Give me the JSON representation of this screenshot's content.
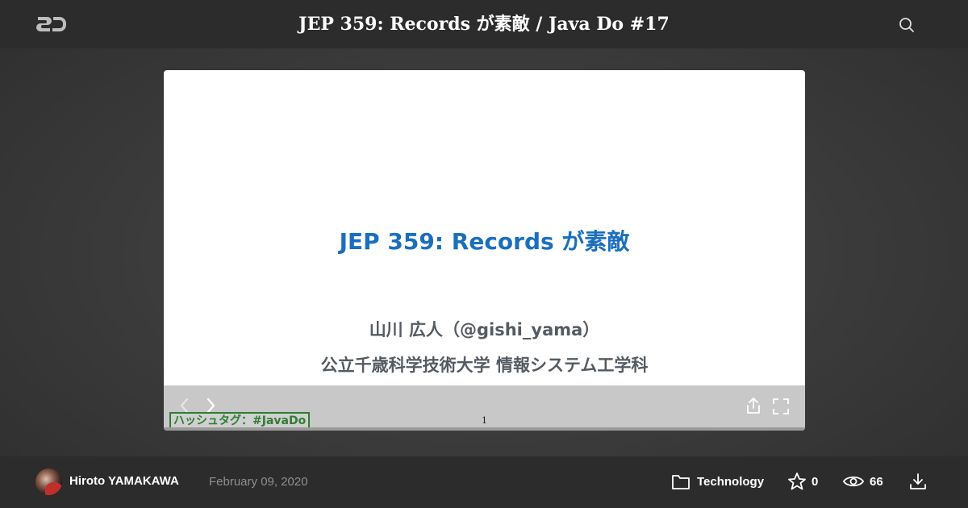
{
  "header": {
    "logo": "SD",
    "title": "JEP 359: Records が素敵 / Java Do #17",
    "search_icon": "search-icon"
  },
  "slide": {
    "title": "JEP 359: Records が素敵",
    "author": "山川 広人（@gishi_yama）",
    "affiliation": "公立千歳科学技術大学 情報システム工学科",
    "hashtag": "ハッシュタグ：#JavaDo",
    "page_number": "1",
    "colors": {
      "title": "#1a6fbd",
      "body": "#555b62",
      "hashtag": "#2e7d32"
    },
    "controls": [
      "chevron-left-icon",
      "chevron-right-icon",
      "share-icon",
      "fullscreen-icon"
    ]
  },
  "footer": {
    "author_name": "Hiroto YAMAKAWA",
    "date": "February 09, 2020",
    "category": "Technology",
    "stars": "0",
    "views": "66",
    "icons": [
      "folder-icon",
      "star-icon",
      "eye-icon",
      "download-icon"
    ]
  }
}
